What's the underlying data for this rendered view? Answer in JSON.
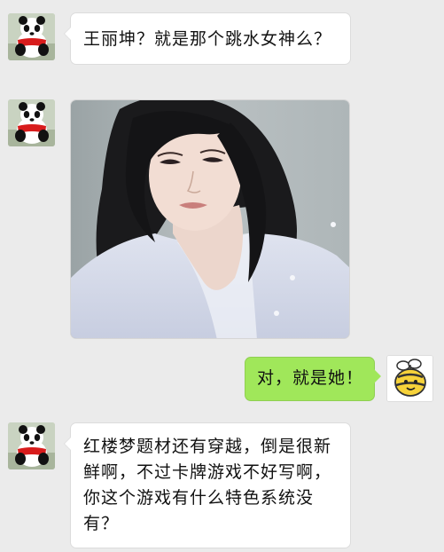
{
  "chat": {
    "messages": [
      {
        "text": "王丽坤？就是那个跳水女神么？"
      },
      {
        "text": ""
      },
      {
        "text": "对，就是她！"
      },
      {
        "text": "红楼梦题材还有穿越，倒是很新鲜啊，不过卡牌游戏不好写啊，你这个游戏有什么特色系统没有？"
      }
    ]
  },
  "colors": {
    "background": "#ebebeb",
    "incoming_bubble": "#ffffff",
    "outgoing_bubble": "#a0e75a"
  },
  "icons": {
    "contact_avatar": "panda-avatar-icon",
    "self_avatar": "bee-avatar-icon"
  }
}
